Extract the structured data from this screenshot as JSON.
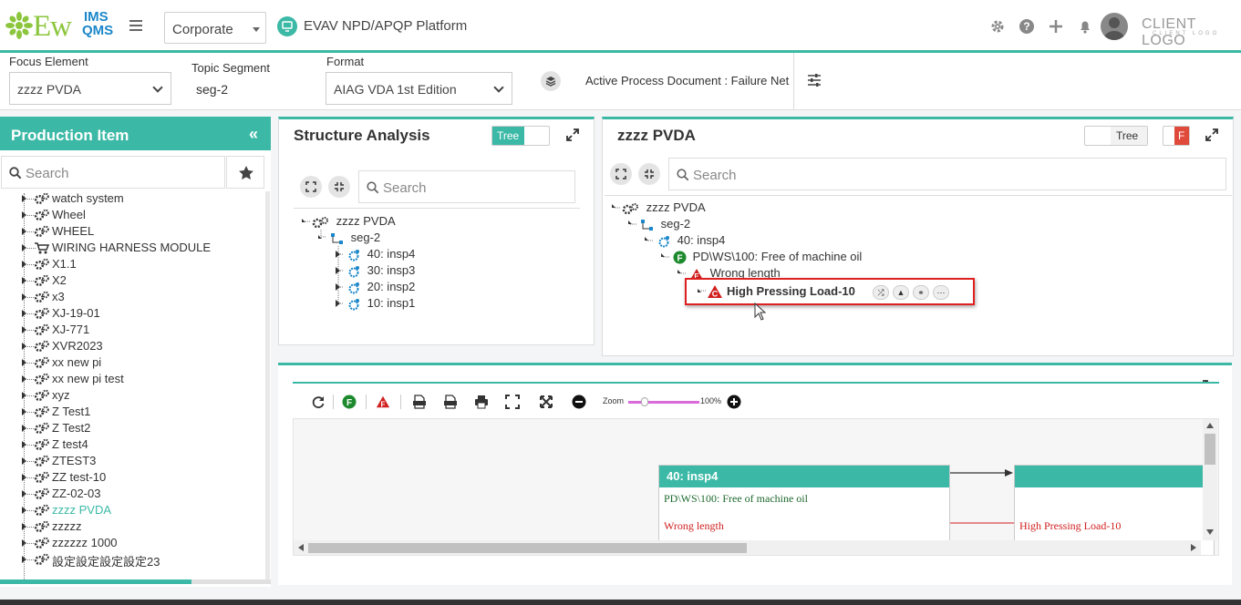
{
  "header": {
    "logo_main": "Ew",
    "logo_ims": "IMS",
    "logo_qms": "QMS",
    "corporate_select": "Corporate",
    "platform_title": "EVAV NPD/APQP Platform",
    "client_logo": "CLIENT LOGO",
    "client_logo_sub": "CLIENT LOGO"
  },
  "focus_bar": {
    "focus_element_label": "Focus Element",
    "focus_element_value": "zzzz PVDA",
    "topic_segment_label": "Topic Segment",
    "topic_segment_value": "seg-2",
    "format_label": "Format",
    "format_value": "AIAG VDA 1st Edition",
    "active_doc": "Active Process Document : Failure Net"
  },
  "left_panel": {
    "title": "Production Item",
    "search_placeholder": "Search",
    "items": [
      "watch system",
      "Wheel",
      "WHEEL",
      "WIRING HARNESS MODULE",
      "X1.1",
      "X2",
      "x3",
      "XJ-19-01",
      "XJ-771",
      "XVR2023",
      "xx new pi",
      "xx new pi test",
      "xyz",
      "Z Test1",
      "Z Test2",
      "Z test4",
      "ZTEST3",
      "ZZ test-10",
      "ZZ-02-03",
      "zzzz PVDA",
      "zzzzz",
      "zzzzzz 1000",
      "設定設定設定設定23"
    ],
    "selected_item": "zzzz PVDA"
  },
  "structure_panel": {
    "title": "Structure Analysis",
    "toggle_label": "Tree",
    "search_placeholder": "Search",
    "root": "zzzz PVDA",
    "segment": "seg-2",
    "children": [
      "40: insp4",
      "30: insp3",
      "20: insp2",
      "10: insp1"
    ]
  },
  "failure_panel": {
    "title": "zzzz PVDA",
    "toggle_label": "Tree",
    "f_badge": "F",
    "search_placeholder": "Search",
    "root": "zzzz PVDA",
    "segment": "seg-2",
    "step": "40: insp4",
    "function": "PD\\WS\\100: Free of machine oil",
    "failure_mode": "Wrong length",
    "cause": "High Pressing Load-10",
    "badge_f": "F",
    "badge_e": "E",
    "badge_c": "C"
  },
  "diagram": {
    "zoom_label": "Zoom",
    "zoom_value": "100%",
    "f_btn": "F",
    "card1_title": "40: insp4",
    "card1_function": "PD\\WS\\100: Free of machine oil",
    "card1_failure": "Wrong length",
    "card2_failure": "High Pressing Load-10"
  },
  "colors": {
    "accent": "#3cb9a6",
    "failure_red": "#e02020",
    "function_green": "#1e8a2e"
  }
}
